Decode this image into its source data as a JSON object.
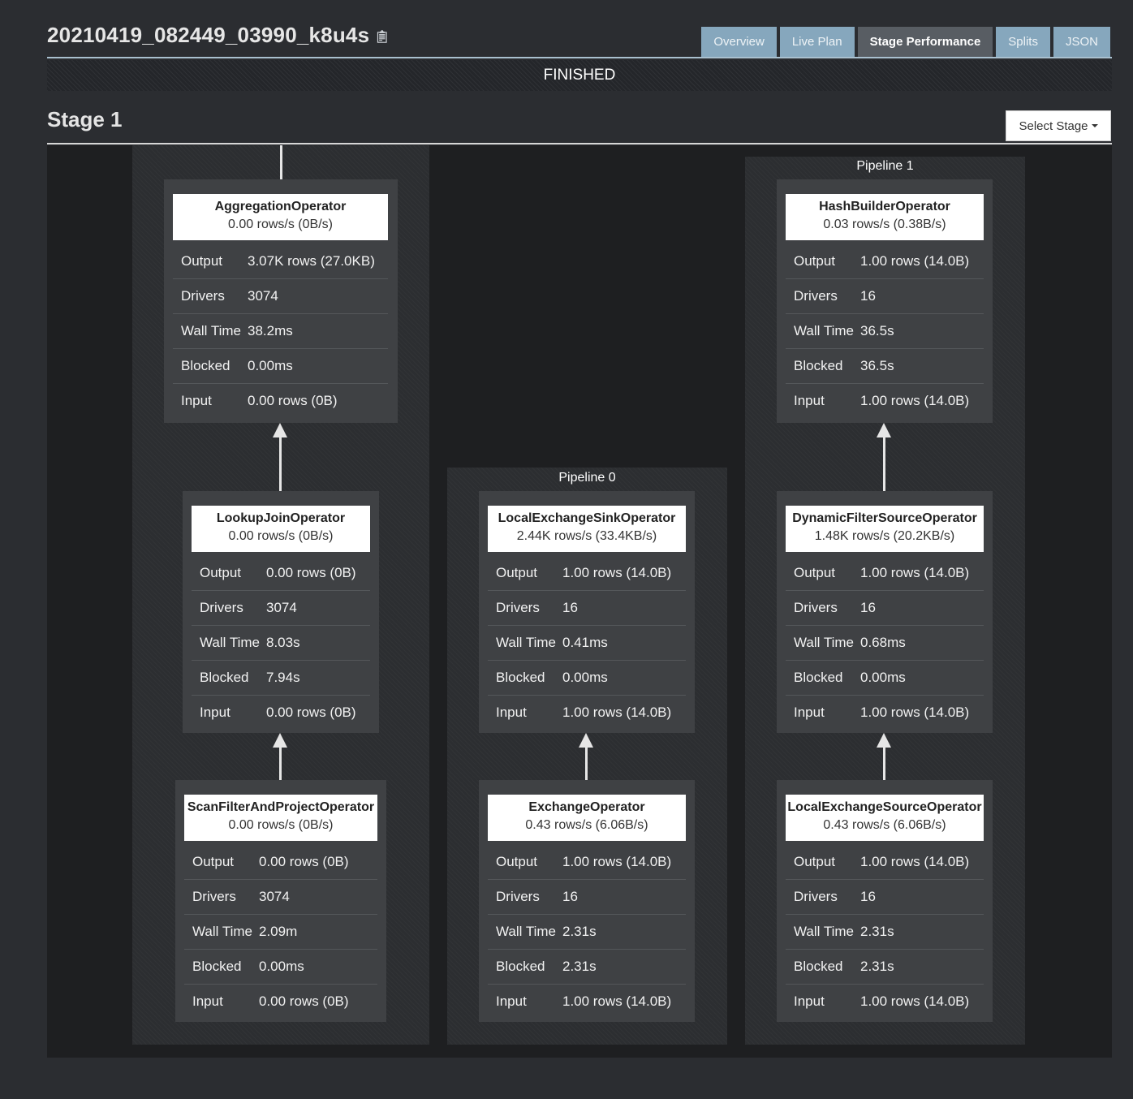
{
  "header": {
    "query_id": "20210419_082449_03990_k8u4s",
    "copy_icon": "clipboard-icon",
    "tabs": [
      {
        "label": "Overview",
        "active": false
      },
      {
        "label": "Live Plan",
        "active": false
      },
      {
        "label": "Stage Performance",
        "active": true
      },
      {
        "label": "Splits",
        "active": false
      },
      {
        "label": "JSON",
        "active": false
      }
    ],
    "status": "FINISHED"
  },
  "stage": {
    "title": "Stage 1",
    "select_label": "Select Stage"
  },
  "pipelines": [
    {
      "label": "",
      "operators": [
        {
          "name": "AggregationOperator",
          "rate": "0.00 rows/s (0B/s)",
          "stats": [
            [
              "Output",
              "3.07K rows (27.0KB)"
            ],
            [
              "Drivers",
              "3074"
            ],
            [
              "Wall Time",
              "38.2ms"
            ],
            [
              "Blocked",
              "0.00ms"
            ],
            [
              "Input",
              "0.00 rows (0B)"
            ]
          ]
        },
        {
          "name": "LookupJoinOperator",
          "rate": "0.00 rows/s (0B/s)",
          "stats": [
            [
              "Output",
              "0.00 rows (0B)"
            ],
            [
              "Drivers",
              "3074"
            ],
            [
              "Wall Time",
              "8.03s"
            ],
            [
              "Blocked",
              "7.94s"
            ],
            [
              "Input",
              "0.00 rows (0B)"
            ]
          ]
        },
        {
          "name": "ScanFilterAndProjectOperator",
          "rate": "0.00 rows/s (0B/s)",
          "stats": [
            [
              "Output",
              "0.00 rows (0B)"
            ],
            [
              "Drivers",
              "3074"
            ],
            [
              "Wall Time",
              "2.09m"
            ],
            [
              "Blocked",
              "0.00ms"
            ],
            [
              "Input",
              "0.00 rows (0B)"
            ]
          ]
        }
      ]
    },
    {
      "label": "Pipeline 0",
      "operators": [
        {
          "name": "LocalExchangeSinkOperator",
          "rate": "2.44K rows/s (33.4KB/s)",
          "stats": [
            [
              "Output",
              "1.00 rows (14.0B)"
            ],
            [
              "Drivers",
              "16"
            ],
            [
              "Wall Time",
              "0.41ms"
            ],
            [
              "Blocked",
              "0.00ms"
            ],
            [
              "Input",
              "1.00 rows (14.0B)"
            ]
          ]
        },
        {
          "name": "ExchangeOperator",
          "rate": "0.43 rows/s (6.06B/s)",
          "stats": [
            [
              "Output",
              "1.00 rows (14.0B)"
            ],
            [
              "Drivers",
              "16"
            ],
            [
              "Wall Time",
              "2.31s"
            ],
            [
              "Blocked",
              "2.31s"
            ],
            [
              "Input",
              "1.00 rows (14.0B)"
            ]
          ]
        }
      ]
    },
    {
      "label": "Pipeline 1",
      "operators": [
        {
          "name": "HashBuilderOperator",
          "rate": "0.03 rows/s (0.38B/s)",
          "stats": [
            [
              "Output",
              "1.00 rows (14.0B)"
            ],
            [
              "Drivers",
              "16"
            ],
            [
              "Wall Time",
              "36.5s"
            ],
            [
              "Blocked",
              "36.5s"
            ],
            [
              "Input",
              "1.00 rows (14.0B)"
            ]
          ]
        },
        {
          "name": "DynamicFilterSourceOperator",
          "rate": "1.48K rows/s (20.2KB/s)",
          "stats": [
            [
              "Output",
              "1.00 rows (14.0B)"
            ],
            [
              "Drivers",
              "16"
            ],
            [
              "Wall Time",
              "0.68ms"
            ],
            [
              "Blocked",
              "0.00ms"
            ],
            [
              "Input",
              "1.00 rows (14.0B)"
            ]
          ]
        },
        {
          "name": "LocalExchangeSourceOperator",
          "rate": "0.43 rows/s (6.06B/s)",
          "stats": [
            [
              "Output",
              "1.00 rows (14.0B)"
            ],
            [
              "Drivers",
              "16"
            ],
            [
              "Wall Time",
              "2.31s"
            ],
            [
              "Blocked",
              "2.31s"
            ],
            [
              "Input",
              "1.00 rows (14.0B)"
            ]
          ]
        }
      ]
    }
  ]
}
